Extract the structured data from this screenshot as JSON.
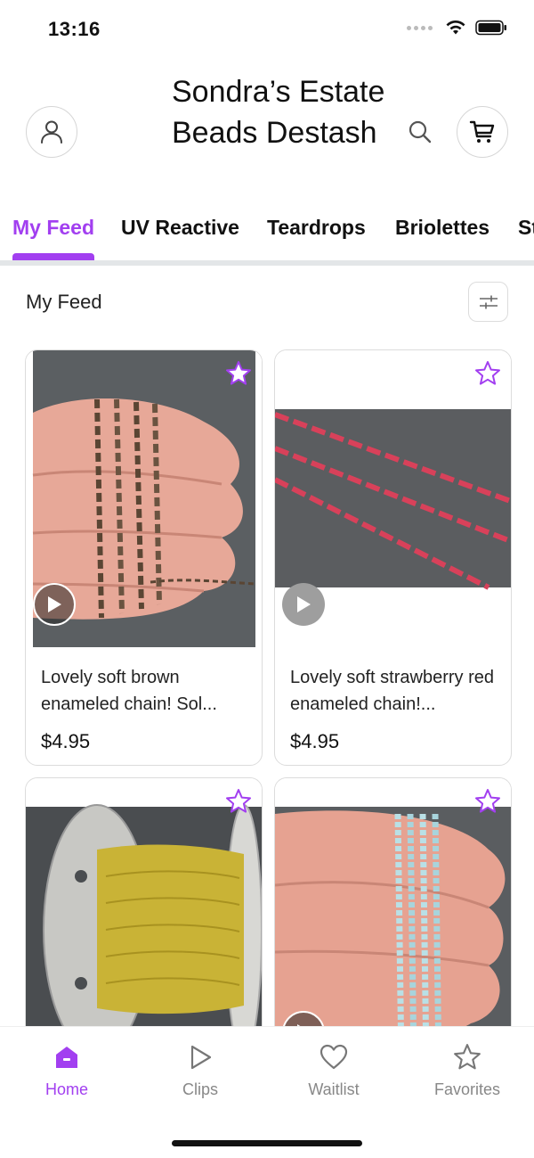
{
  "status_bar": {
    "time": "13:16"
  },
  "header": {
    "title": "Sondra’s Estate Beads Destash",
    "profile_icon": "user-icon",
    "search_icon": "search-icon",
    "cart_icon": "cart-icon"
  },
  "tabs": [
    {
      "label": "My Feed",
      "active": true
    },
    {
      "label": "UV Reactive"
    },
    {
      "label": "Teardrops"
    },
    {
      "label": "Briolettes"
    },
    {
      "label": "St"
    }
  ],
  "feed": {
    "title": "My Feed",
    "filter_icon": "sliders-icon"
  },
  "products": [
    {
      "name": "Lovely soft brown enameled chain! Sol...",
      "price": "$4.95",
      "has_video": true,
      "image": "brown chain on hand"
    },
    {
      "name": "Lovely soft strawberry red enameled chain!...",
      "price": "$4.95",
      "has_video": true,
      "image": "red chain on gray cloth"
    },
    {
      "name": "",
      "price": "",
      "has_video": false,
      "image": "yellow chain on spool"
    },
    {
      "name": "",
      "price": "",
      "has_video": true,
      "image": "light blue chain on hand"
    }
  ],
  "bottom_nav": [
    {
      "label": "Home",
      "icon": "home-icon",
      "active": true
    },
    {
      "label": "Clips",
      "icon": "play-icon"
    },
    {
      "label": "Waitlist",
      "icon": "heart-icon"
    },
    {
      "label": "Favorites",
      "icon": "star-icon"
    }
  ],
  "colors": {
    "accent": "#a23ff0",
    "muted": "#888888",
    "border": "#dcdcdc"
  }
}
